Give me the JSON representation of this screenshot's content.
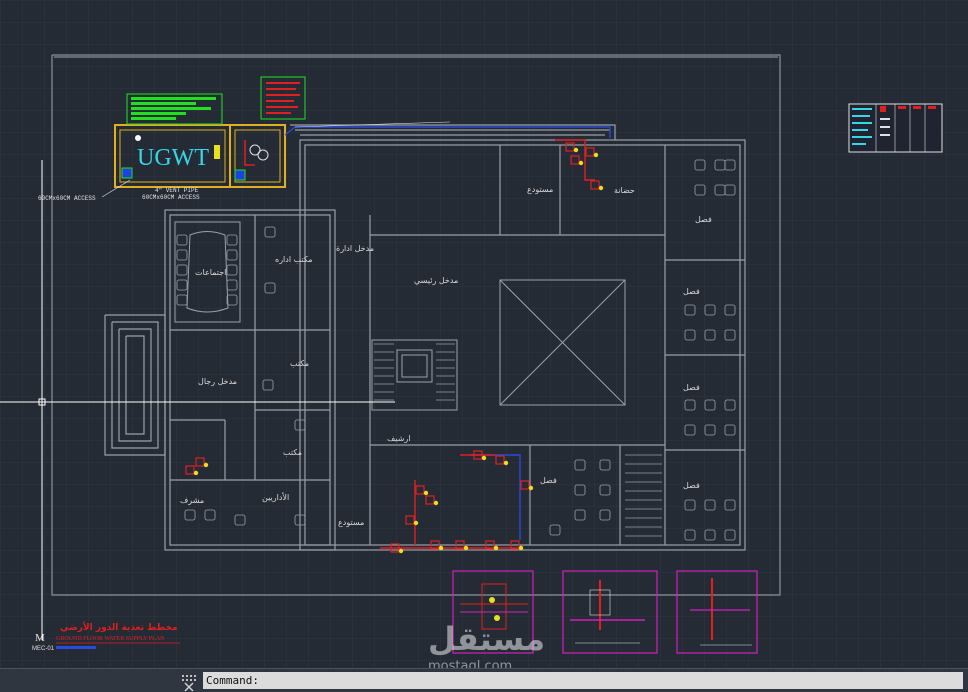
{
  "drawing": {
    "tank_label": "UGWT",
    "vent_note": "4\" VENT PIPE",
    "access_note_left": "60CMx60CM ACCESS",
    "access_note_right": "60CMx60CM ACCESS",
    "title_arabic": "مخطط تغذية الدور الأرضي",
    "title_english": "GROUND FLOOR WATER SUPPLY PLAN",
    "sheet_code": "MEC-01",
    "sheet_letter": "M",
    "rooms": {
      "meeting": "اجتماعات",
      "admin_office": "مكتب اداره",
      "warehouse_top": "مستودع",
      "kitchen": "حضانة",
      "admin_entrance": "مدخل ادارة",
      "main_entrance": "مدخل رئيسي",
      "men_entrance": "مدخل رجال",
      "office_a": "مكتب",
      "office_b": "مكتب",
      "supervisor": "مشرف",
      "teachers": "الأداريين",
      "reception": "ارشيف",
      "warehouse_bottom": "مستودع",
      "class_1": "فصل",
      "class_2": "فصل",
      "class_3": "فصل",
      "class_4": "فصل",
      "class_5": "فصل"
    }
  },
  "watermark": {
    "brand_ar": "مستقل",
    "brand_en": "mostaql.com"
  },
  "command_line": {
    "prompt": "Command:"
  },
  "colors": {
    "background": "#252b35",
    "grid": "#2f3643",
    "walls": "#9aa0a8",
    "tank_border": "#e0b020",
    "cyan_text": "#35d6e6",
    "red": "#e02020",
    "magenta": "#d020c0",
    "green": "#20e020",
    "blue": "#2a4ad8"
  }
}
